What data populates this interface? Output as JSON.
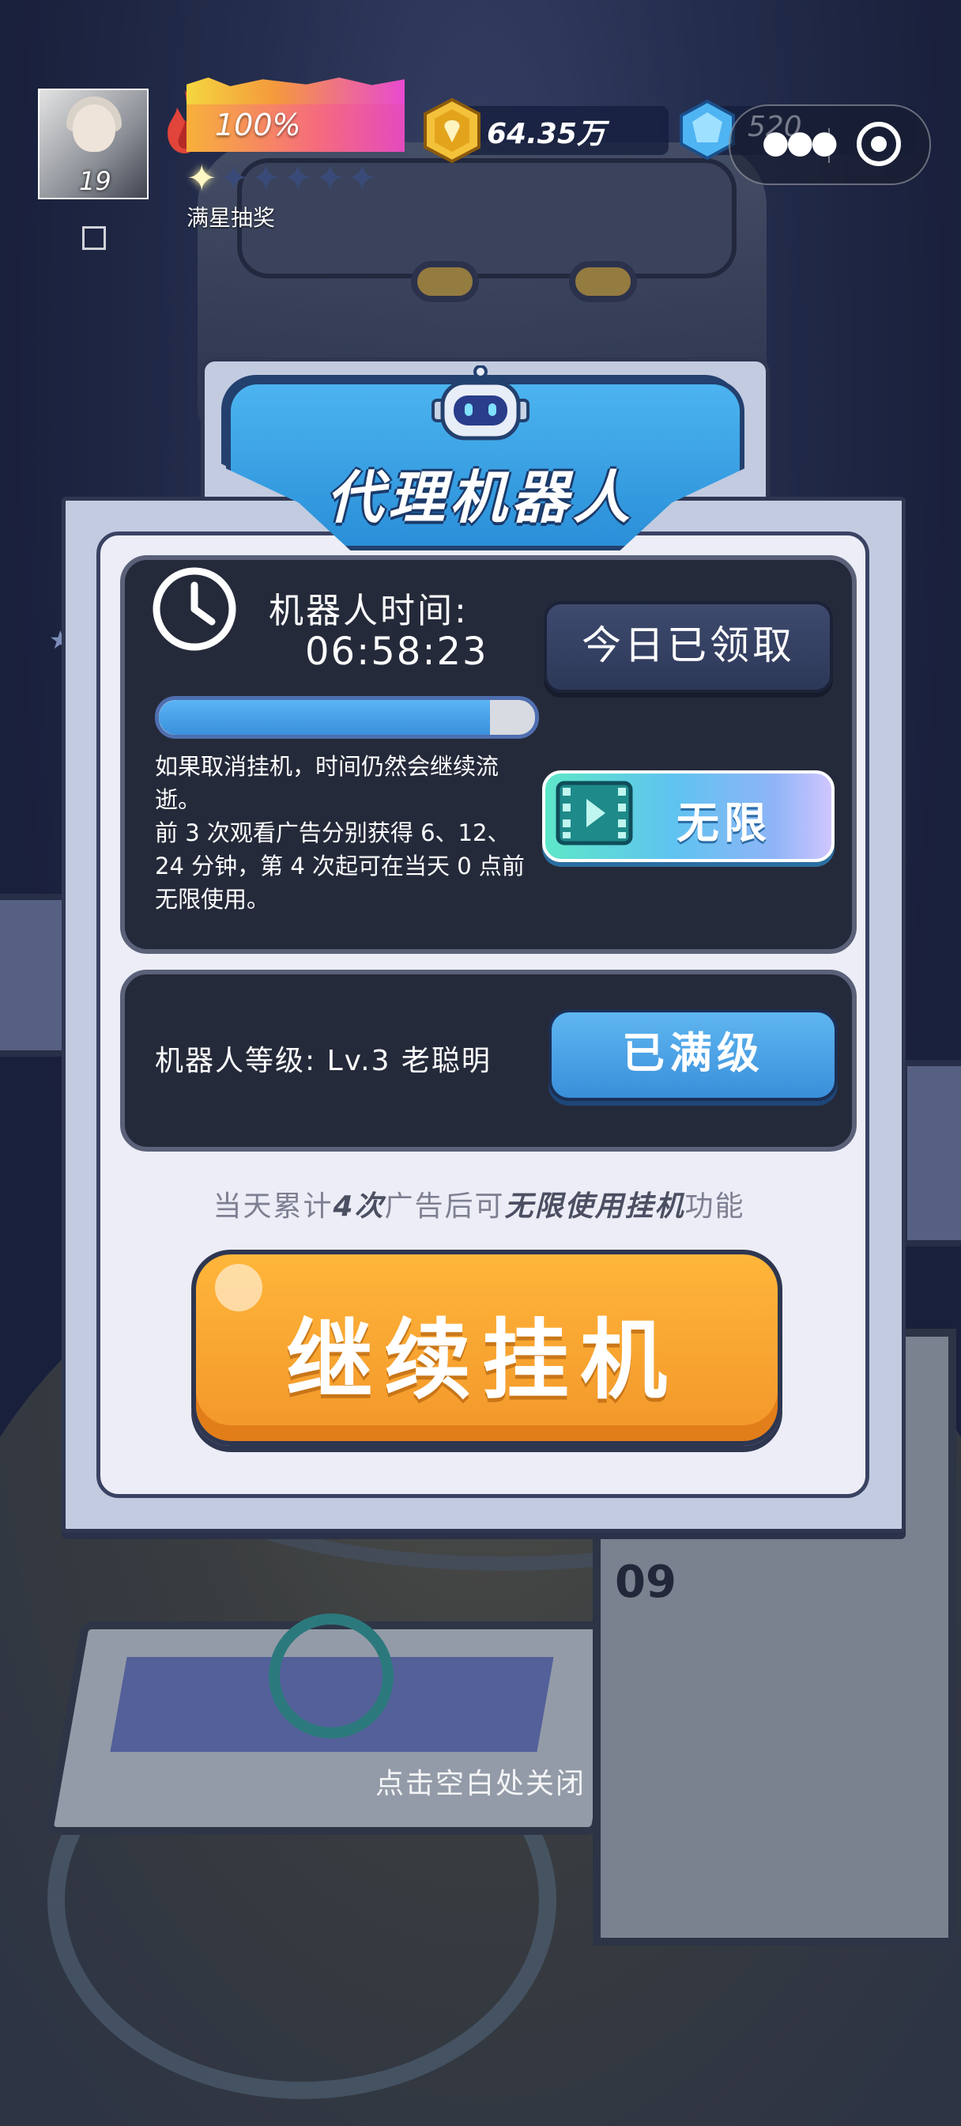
{
  "hud": {
    "avatar_level": "19",
    "energy_percent": "100%",
    "energy_fill": 1.0,
    "stars_on": 1,
    "stars_total": 6,
    "stars_label": "满星抽奖",
    "coins": "64.35万",
    "gems": "520"
  },
  "dialog": {
    "title": "代理机器人",
    "robot_time_label": "机器人时间:",
    "robot_time_value": "06:58:23",
    "robot_time_progress": 0.88,
    "claimed_button": "今日已领取",
    "unlimited_button": "无限",
    "description_lines": [
      "如果取消挂机，时间仍然会继续流逝。",
      "前 3 次观看广告分别获得 6、12、24 分钟，第 4 次起可在当天 0 点前无限使用。"
    ],
    "level_label": "机器人等级: Lv.3 老聪明",
    "maxed_button": "已满级",
    "hint_parts": [
      "当天累计",
      "4次",
      "广告后可",
      "无限使用挂机",
      "功能"
    ],
    "continue_button": "继续挂机"
  },
  "close_hint": "点击空白处关闭",
  "colors": {
    "accent_blue": "#3a8fda",
    "continue_orange": "#f7a32e",
    "card_dark": "#252a3a"
  }
}
